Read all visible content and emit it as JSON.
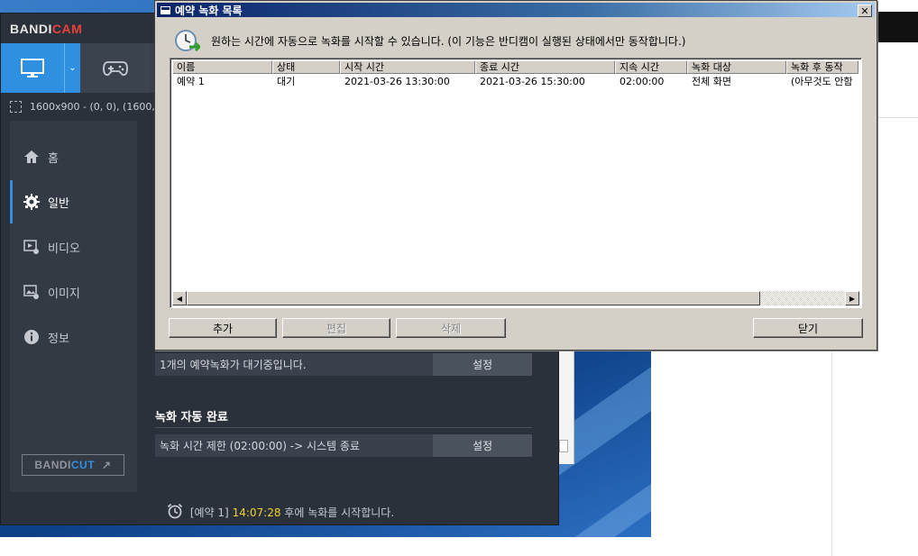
{
  "bandicam": {
    "logo_main": "BANDI",
    "logo_accent": "CAM",
    "toolbar": {
      "screen_mode_icon": "monitor-icon",
      "dropdown_icon": "chevron-down-icon",
      "game_mode_icon": "gamepad-icon"
    },
    "status": "1600x900 - (0, 0), (1600,",
    "sidebar": {
      "items": [
        {
          "label": "홈",
          "icon": "home-icon"
        },
        {
          "label": "일반",
          "icon": "gear-icon"
        },
        {
          "label": "비디오",
          "icon": "video-settings-icon"
        },
        {
          "label": "이미지",
          "icon": "image-settings-icon"
        },
        {
          "label": "정보",
          "icon": "info-icon"
        }
      ],
      "bandicut_main": "BANDI",
      "bandicut_accent": "CUT",
      "bandicut_arrow": "↗"
    },
    "main": {
      "reservation_text": "1개의 예약녹화가 대기중입니다.",
      "reservation_button": "설정",
      "auto_complete_title": "녹화 자동 완료",
      "auto_complete_text": "녹화 시간 제한 (02:00:00) -> 시스템 종료",
      "auto_complete_button": "설정"
    },
    "footer": {
      "prefix": "[예약 1]",
      "time": "14:07:28",
      "suffix": "후에 녹화를 시작합니다."
    }
  },
  "dialog": {
    "title": "예약 녹화 목록",
    "close": "✕",
    "info": "원하는 시간에 자동으로 녹화를 시작할 수 있습니다. (이 기능은 반디캠이 실행된 상태에서만 동작합니다.)",
    "columns": [
      "이름",
      "상태",
      "시작 시간",
      "종료 시간",
      "지속 시간",
      "녹화 대상",
      "녹화 후 동작"
    ],
    "rows": [
      [
        "예약 1",
        "대기",
        "2021-03-26 13:30:00",
        "2021-03-26 15:30:00",
        "02:00:00",
        "전체 화면",
        "(아무것도 안함"
      ]
    ],
    "buttons": {
      "add": "추가",
      "edit": "편집",
      "delete": "삭제",
      "close": "닫기"
    },
    "scroll_left": "◀",
    "scroll_right": "▶"
  }
}
